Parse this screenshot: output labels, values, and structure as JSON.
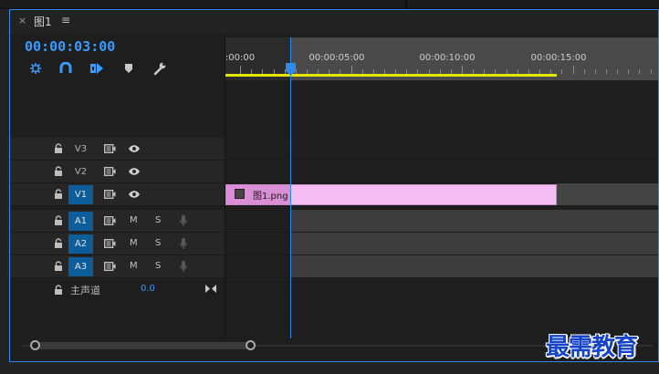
{
  "tab": {
    "close_glyph": "×",
    "title": "图1",
    "menu_glyph": "≡"
  },
  "timecode": "00:00:03:00",
  "tools": [
    {
      "name": "snap-nest-icon"
    },
    {
      "name": "magnet-snap-icon"
    },
    {
      "name": "linked-selection-icon"
    },
    {
      "name": "add-marker-icon"
    },
    {
      "name": "wrench-settings-icon"
    }
  ],
  "ruler": {
    "labels": [
      ":00:00",
      "00:00:05:00",
      "00:00:10:00",
      "00:00:15:00"
    ]
  },
  "tracks": {
    "video": [
      {
        "name": "V3",
        "active": false
      },
      {
        "name": "V2",
        "active": false
      },
      {
        "name": "V1",
        "active": true
      }
    ],
    "audio": [
      {
        "name": "A1",
        "mute": "M",
        "solo": "S",
        "active": true
      },
      {
        "name": "A2",
        "mute": "M",
        "solo": "S",
        "active": true
      },
      {
        "name": "A3",
        "mute": "M",
        "solo": "S",
        "active": true
      }
    ],
    "master": {
      "label": "主声道",
      "value": "0.0"
    }
  },
  "clip": {
    "name": "图1.png"
  },
  "watermark": "最需教育",
  "colors": {
    "accent": "#2d8ceb",
    "timecode": "#3a9bff",
    "clip": "#f6bdf4",
    "workarea": "#e5e500"
  }
}
